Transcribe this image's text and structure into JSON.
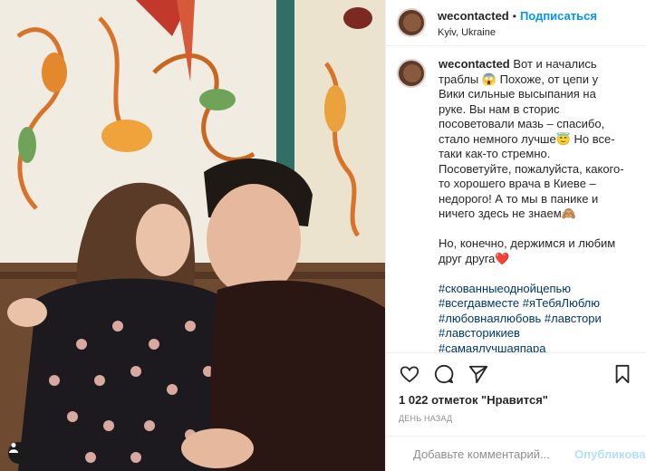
{
  "post": {
    "username": "wecontacted",
    "follow_label": "Подписаться",
    "separator": "•",
    "location": "Kyiv, Ukraine",
    "caption_username": "wecontacted",
    "caption_text": "Вот и начались траблы 😱 Похоже, от цепи у Вики сильные высыпания на руке. Вы нам в сторис посоветовали мазь – спасибо, стало немного лучше😇 Но все-таки как-то стремно. Посоветуйте, пожалуйста, какого-то хорошего врача в Киеве – недорого! А то мы в панике и ничего здесь не знаем🙈\n\nНо, конечно, держимся и любим друг друга❤️",
    "hashtags": "#скованныеоднойцепью\n#всегдавместе #яТебяЛюблю\n#любовнаялюбовь #лавстори\n#лавсторикиев #самаялучшаяпара\n#парагода #красиваяпара #love\n#loveyou #lovestory\n#настоящаялюбовь #valentineday",
    "likes_text": "1 022 отметок \"Нравится\"",
    "time_ago": "ДЕНЬ НАЗАД",
    "comment_placeholder": "Добавьте комментарий...",
    "publish_label": "Опубликовать"
  },
  "icons": {
    "like": "heart-outline",
    "comment": "speech-bubble-outline",
    "share": "paper-plane-outline",
    "save": "bookmark-outline",
    "emoji": "smiley-face",
    "tag": "person-tag"
  },
  "colors": {
    "link": "#0095f6",
    "hashtag": "#00376b",
    "muted": "#8e8e8e",
    "text": "#262626",
    "border": "#efefef",
    "publish_disabled": "#b2dffc"
  }
}
